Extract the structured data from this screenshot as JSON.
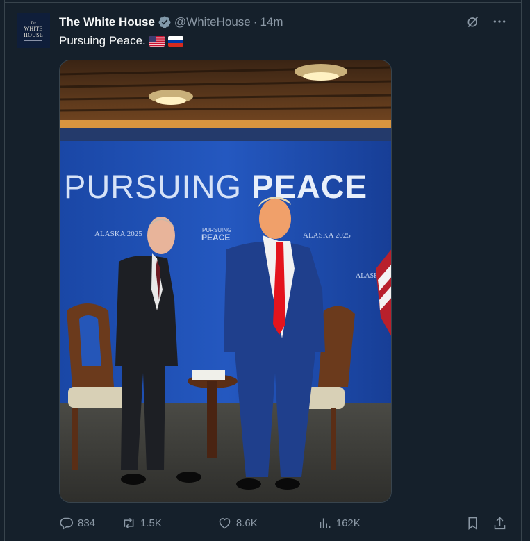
{
  "tweet": {
    "author_name": "The White House",
    "handle": "@WhiteHouse",
    "separator": "·",
    "time": "14m",
    "text": "Pursuing Peace.",
    "flags": [
      "us-flag",
      "russia-flag"
    ]
  },
  "avatar": {
    "line1": "The",
    "line2": "WHITE",
    "line3": "HOUSE"
  },
  "media": {
    "banner_text_light": "PURSUING ",
    "banner_text_bold": "PEACE",
    "small_logo_top": "PURSUING",
    "small_logo_bottom": "PEACE",
    "event_text_left": "ALASKA 2025",
    "event_text_right": "ALASKA 2025",
    "event_text_far_right": "ALASKA"
  },
  "actions": {
    "replies": "834",
    "reposts": "1.5K",
    "likes": "8.6K",
    "views": "162K"
  },
  "colors": {
    "background": "#15202b",
    "border": "#38444d",
    "muted_text": "#8b98a5",
    "verified": "#829aab",
    "backdrop_blue": "#1b4fb3"
  }
}
